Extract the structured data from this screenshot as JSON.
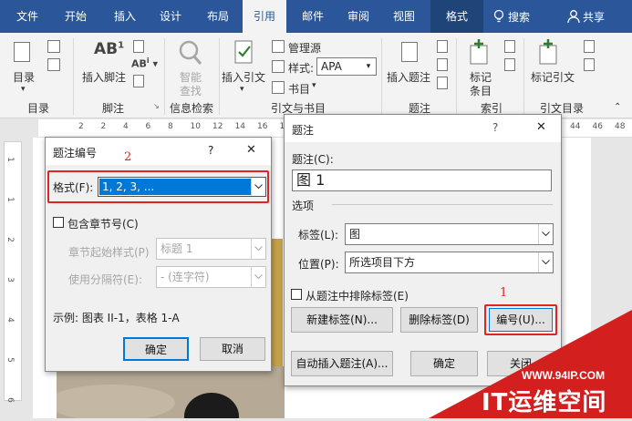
{
  "ribbon": {
    "tabs": [
      "文件",
      "开始",
      "插入",
      "设计",
      "布局",
      "引用",
      "邮件",
      "审阅",
      "视图",
      "格式"
    ],
    "active_tab": "引用",
    "search_label": "搜索",
    "share_label": "共享",
    "groups": {
      "toc": {
        "button": "目录",
        "label": "目录"
      },
      "footnotes": {
        "insert": "插入脚注",
        "ab1": "AB",
        "ab1_sup": "1",
        "ab2": "AB",
        "ab2_sup": "i",
        "label": "脚注"
      },
      "research": {
        "button": "智能",
        "button2": "查找",
        "label": "信息检索"
      },
      "citations": {
        "insert": "插入引文",
        "manage": "管理源",
        "style_label": "样式:",
        "style_value": "APA",
        "bibliography": "书目",
        "label": "引文与书目"
      },
      "captions": {
        "insert": "插入题注",
        "label": "题注"
      },
      "index": {
        "mark": "标记",
        "mark2": "条目",
        "label": "索引"
      },
      "toa": {
        "mark": "标记引文",
        "label": "引文目录"
      }
    },
    "colors": {
      "ribbon": "#2b579a",
      "highlight": "#0078d7",
      "red": "#e02424"
    }
  },
  "ruler_numbers": [
    "2",
    "2",
    "4",
    "6",
    "8",
    "10",
    "12",
    "14",
    "16",
    "18",
    "20",
    "22",
    "24",
    "26",
    "28",
    "30",
    "32",
    "34",
    "36",
    "38",
    "40",
    "42",
    "44",
    "46",
    "48"
  ],
  "vruler_numbers": [
    "1",
    "1",
    "2",
    "3",
    "4",
    "5",
    "6"
  ],
  "caption_dialog": {
    "title": "题注",
    "help": "?",
    "close": "✕",
    "caption_label": "题注(C):",
    "caption_value": "图  1",
    "options_label": "选项",
    "label_field": "标签(L):",
    "label_value": "图",
    "position_field": "位置(P):",
    "position_value": "所选项目下方",
    "exclude_label": "从题注中排除标签(E)",
    "new_label_btn": "新建标签(N)...",
    "delete_label_btn": "删除标签(D)",
    "numbering_btn": "编号(U)...",
    "autocaption_btn": "自动插入题注(A)...",
    "ok_btn": "确定",
    "close_btn": "关闭",
    "step_number": "1"
  },
  "numbering_dialog": {
    "title": "题注编号",
    "help": "?",
    "close": "✕",
    "format_label": "格式(F):",
    "format_value": "1, 2, 3, ...",
    "include_chapter": "包含章节号(C)",
    "chapter_style_label": "章节起始样式(P)",
    "chapter_style_value": "标题 1",
    "separator_label": "使用分隔符(E):",
    "separator_value": "-    (连字符)",
    "example": "示例: 图表 II-1，表格 1-A",
    "ok_btn": "确定",
    "cancel_btn": "取消",
    "step_number": "2"
  },
  "watermark": {
    "url": "WWW.94IP.COM",
    "brand": "IT运维空间"
  }
}
